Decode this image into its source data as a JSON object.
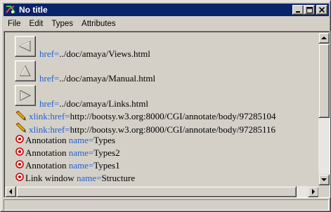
{
  "window": {
    "title": "No title",
    "buttons": {
      "minimize": "_",
      "maximize": "□",
      "close": "×"
    }
  },
  "menu": [
    "File",
    "Edit",
    "Types",
    "Attributes"
  ],
  "content": {
    "image_links": [
      {
        "attr": "href=",
        "value": "../doc/amaya/Views.html",
        "icon": "views-icon"
      },
      {
        "attr": "href=",
        "value": "../doc/amaya/Manual.html",
        "icon": "manual-icon"
      },
      {
        "attr": "href=",
        "value": "../doc/amaya/Links.html",
        "icon": "links-icon"
      }
    ],
    "xlinks": [
      {
        "attr": "xlink:href=",
        "value": "http://bootsy.w3.org:8000/CGI/annotate/body/97285104",
        "icon": "pencil-icon"
      },
      {
        "attr": "xlink:href=",
        "value": "http://bootsy.w3.org:8000/CGI/annotate/body/97285116",
        "icon": "pencil-icon"
      }
    ],
    "annotations": [
      {
        "label": "Annotation",
        "attr": "name=",
        "value": "Types",
        "icon": "target-icon"
      },
      {
        "label": "Annotation",
        "attr": "name=",
        "value": "Types2",
        "icon": "target-icon"
      },
      {
        "label": "Annotation",
        "attr": "name=",
        "value": "Types1",
        "icon": "target-icon"
      },
      {
        "label": "Link window",
        "attr": "name=",
        "value": "Structure",
        "icon": "target-icon"
      }
    ]
  },
  "colors": {
    "titlebar": "#0a246a",
    "attribute": "#1f5fd0",
    "target": "#cc0000",
    "pencil": "#e8a800"
  },
  "scroll": {
    "vertical_position": 0,
    "horizontal_position": 0
  }
}
